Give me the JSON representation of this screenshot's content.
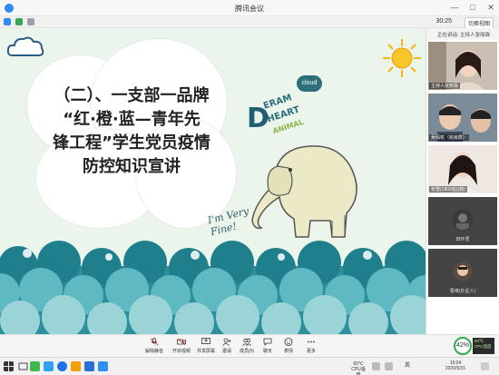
{
  "window": {
    "title": "腾讯会议",
    "minimize": "—",
    "maximize": "□",
    "close": "✕"
  },
  "status_bar": {
    "time": "30:25",
    "switch_label": "切换视图"
  },
  "slide": {
    "title_lines": [
      "（二）、一支部一品牌",
      "“红·橙·蓝—青年先",
      "锋工程”学生党员疫情",
      "防控知识宣讲"
    ],
    "deco": {
      "d": "D",
      "eram": "ERAM",
      "heart": "HEART",
      "animal": "ANIMAL",
      "cloud": "cloud",
      "fine_line1": "I'm Very",
      "fine_line2": "Fine!"
    },
    "colors": {
      "background": "#ecf5ec",
      "sea_dark": "#2c8f9b",
      "sea_mid": "#5fb9c2",
      "sea_light": "#9ad4d6",
      "sun": "#f7b21a"
    }
  },
  "participants_panel": {
    "speaking_label": "正在讲话: 主持人张丽霖",
    "participants": [
      {
        "name": "主持人张丽霖",
        "type": "video"
      },
      {
        "name": "吴佩权（班级群）",
        "type": "video"
      },
      {
        "name": "安雪(1802班)(我)",
        "type": "video"
      },
      {
        "name": "田环君",
        "type": "avatar"
      },
      {
        "name": "曹维(外星人)",
        "type": "avatar"
      }
    ]
  },
  "toolbar": {
    "items": [
      {
        "label": "解除静音",
        "icon": "microphone-muted-icon"
      },
      {
        "label": "开启视频",
        "icon": "camera-off-icon"
      },
      {
        "label": "共享屏幕",
        "icon": "share-screen-icon"
      },
      {
        "label": "邀请",
        "icon": "invite-icon"
      },
      {
        "label": "成员(5)",
        "icon": "members-icon"
      },
      {
        "label": "聊天",
        "icon": "chat-icon"
      },
      {
        "label": "表情",
        "icon": "emoji-icon"
      },
      {
        "label": "更多",
        "icon": "more-icon"
      }
    ],
    "performance": {
      "percent": "42%",
      "temp": "60℃",
      "cpu": "CPU温度"
    }
  },
  "taskbar": {
    "temperature": "60℃",
    "temp_label": "CPU温度",
    "clock_time": "15:04",
    "clock_date": "2020/5/31",
    "lang": "英"
  }
}
